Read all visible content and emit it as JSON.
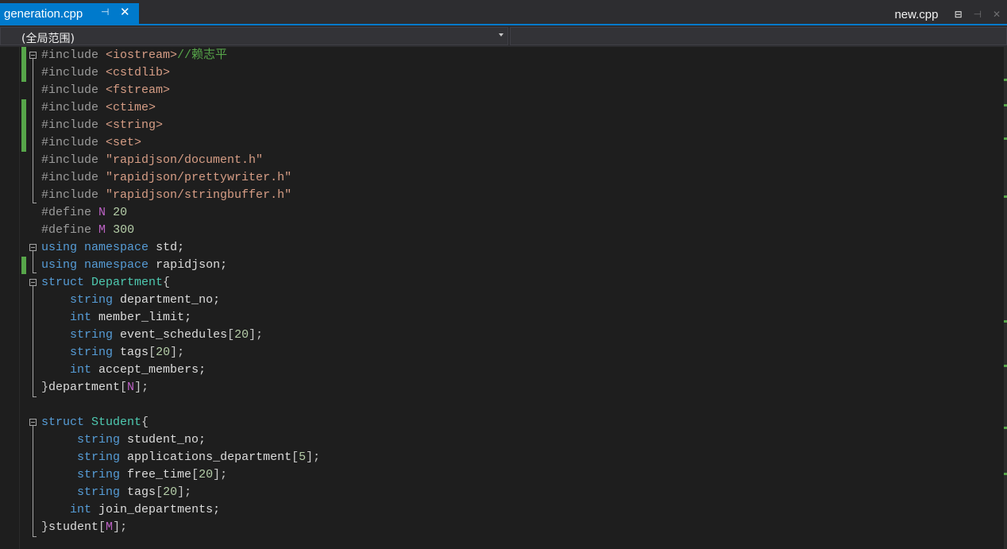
{
  "tabs": {
    "active": {
      "label": "generation.cpp",
      "pin_icon": "pin-icon",
      "close_icon": "close-icon"
    },
    "right": {
      "label": "new.cpp",
      "icons": [
        "preview-lock-icon",
        "pin-icon",
        "close-icon"
      ]
    }
  },
  "navbar": {
    "scope_label": "(全局范围)",
    "dropdown_icon": "chevron-down-icon"
  },
  "colors": {
    "accent": "#007acc",
    "editor_bg": "#1e1e1e",
    "keyword": "#569cd6",
    "type": "#4ec9b0",
    "string": "#d69d85",
    "comment": "#57a64a",
    "number": "#b5cea8",
    "macro": "#bd63c5",
    "preprocessor": "#9b9b9b"
  },
  "code": {
    "l1": {
      "pp": "#include",
      "s": "<iostream>",
      "comment": "//赖志平"
    },
    "l2": {
      "pp": "#include",
      "s": "<cstdlib>"
    },
    "l3": {
      "pp": "#include",
      "s": "<fstream>"
    },
    "l4": {
      "pp": "#include",
      "s": "<ctime>"
    },
    "l5": {
      "pp": "#include",
      "s": "<string>"
    },
    "l6": {
      "pp": "#include",
      "s": "<set>"
    },
    "l7": {
      "pp": "#include",
      "s": "\"rapidjson/document.h\""
    },
    "l8": {
      "pp": "#include",
      "s": "\"rapidjson/prettywriter.h\""
    },
    "l9": {
      "pp": "#include",
      "s": "\"rapidjson/stringbuffer.h\""
    },
    "l10": {
      "pp": "#define",
      "name": "N",
      "val": "20"
    },
    "l11": {
      "pp": "#define",
      "name": "M",
      "val": "300"
    },
    "l12": {
      "kw1": "using",
      "kw2": "namespace",
      "rest": "std;"
    },
    "l13": {
      "kw1": "using",
      "kw2": "namespace",
      "rest": "rapidjson;"
    },
    "l14": {
      "kw": "struct",
      "name": "Department",
      "brace": "{"
    },
    "l15": {
      "type": "string",
      "rest": "department_no;"
    },
    "l16": {
      "type": "int",
      "rest": "member_limit;"
    },
    "l17": {
      "type": "string",
      "ident": "event_schedules",
      "open": "[",
      "num": "20",
      "close": "];"
    },
    "l18": {
      "type": "string",
      "ident": "tags",
      "open": "[",
      "num": "20",
      "close": "];"
    },
    "l19": {
      "type": "int",
      "rest": "accept_members;"
    },
    "l20": {
      "brace": "}",
      "ident": "department",
      "open": "[",
      "macro": "N",
      "close": "];"
    },
    "l22": {
      "kw": "struct",
      "name": "Student",
      "brace": "{"
    },
    "l23": {
      "type": "string",
      "rest": "student_no;"
    },
    "l24": {
      "type": "string",
      "ident": "applications_department",
      "open": "[",
      "num": "5",
      "close": "];"
    },
    "l25": {
      "type": "string",
      "ident": "free_time",
      "open": "[",
      "num": "20",
      "close": "];"
    },
    "l26": {
      "type": "string",
      "ident": "tags",
      "open": "[",
      "num": "20",
      "close": "];"
    },
    "l27": {
      "type": "int",
      "rest": "join_departments;"
    },
    "l28": {
      "brace": "}",
      "ident": "student",
      "open": "[",
      "macro": "M",
      "close": "];"
    }
  }
}
